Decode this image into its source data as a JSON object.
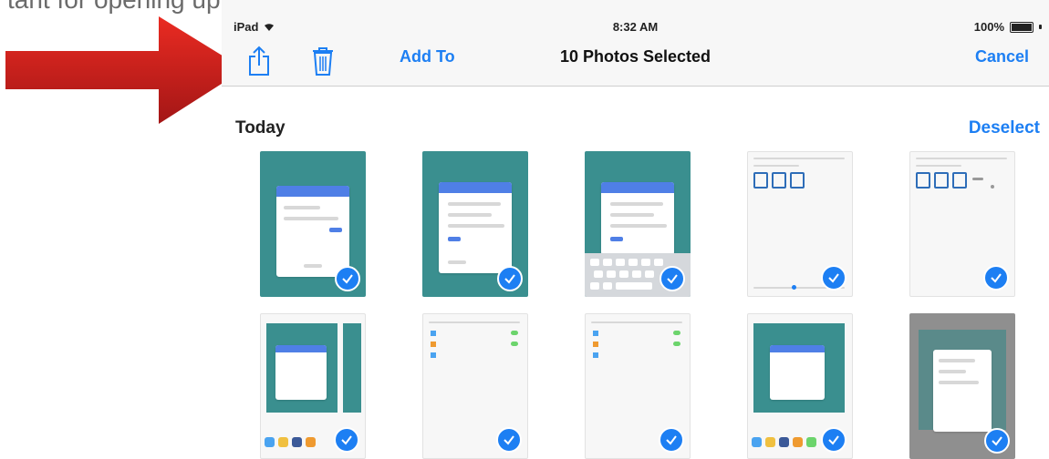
{
  "status": {
    "device": "iPad",
    "time": "8:32 AM",
    "battery": "100%"
  },
  "nav": {
    "add_to": "Add To",
    "title": "10 Photos Selected",
    "cancel": "Cancel"
  },
  "section": {
    "title": "Today",
    "deselect": "Deselect"
  },
  "icons": {
    "share": "share-icon",
    "trash": "trash-icon",
    "check": "checkmark-icon",
    "arrow": "red-arrow"
  },
  "colors": {
    "accent": "#1d7ff3",
    "arrow": "#d62020",
    "teal": "#3a8f8f"
  },
  "photos": {
    "selected_count": 10
  }
}
